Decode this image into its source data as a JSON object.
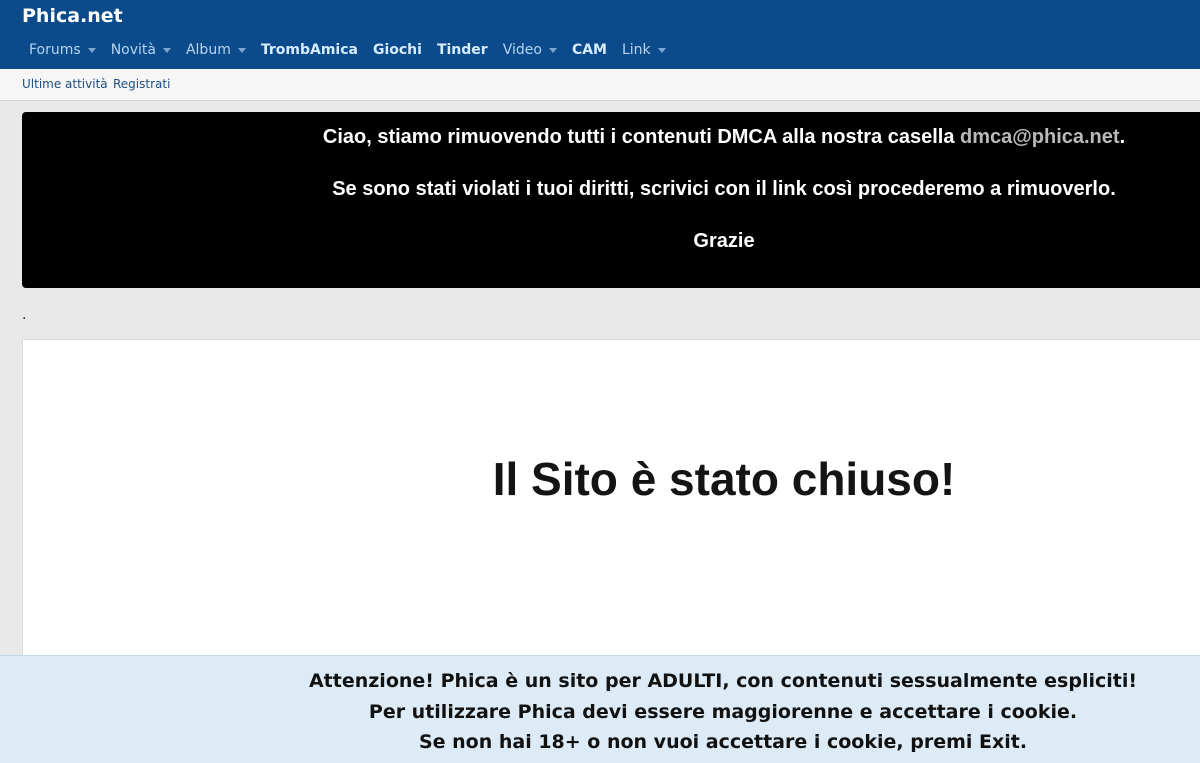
{
  "header": {
    "site_title": "Phica.net",
    "nav": [
      {
        "label": "Forums",
        "dropdown": true,
        "bold": false
      },
      {
        "label": "Novità",
        "dropdown": true,
        "bold": false
      },
      {
        "label": "Album",
        "dropdown": true,
        "bold": false
      },
      {
        "label": "TrombAmica",
        "dropdown": false,
        "bold": true
      },
      {
        "label": "Giochi",
        "dropdown": false,
        "bold": true
      },
      {
        "label": "Tinder",
        "dropdown": false,
        "bold": true
      },
      {
        "label": "Video",
        "dropdown": true,
        "bold": false
      },
      {
        "label": "CAM",
        "dropdown": false,
        "bold": true
      },
      {
        "label": "Link",
        "dropdown": true,
        "bold": false
      }
    ]
  },
  "subnav": {
    "recent_activity": "Ultime attività",
    "register": "Registrati"
  },
  "notice": {
    "line1_text": "Ciao, stiamo rimuovendo tutti i contenuti DMCA alla nostra casella ",
    "line1_email": "dmca@phica.net",
    "line1_end": ".",
    "line2": "Se sono stati violati i tuoi diritti, scrivici con il link così procederemo a rimuoverlo.",
    "line3": "Grazie"
  },
  "separator_dot": ".",
  "main": {
    "closed_title": "Il Sito è stato chiuso!"
  },
  "cookie_notice": {
    "line1": "Attenzione! Phica è un sito per ADULTI, con contenuti sessualmente espliciti!",
    "line2": "Per utilizzare Phica devi essere maggiorenne e accettare i cookie.",
    "line3": "Se non hai 18+ o non vuoi accettare i cookie, premi Exit."
  },
  "colors": {
    "header_bg": "#0b4a8b",
    "notice_bg": "#000000",
    "cookie_bg": "#dcebf5",
    "link": "#1d4f83"
  }
}
